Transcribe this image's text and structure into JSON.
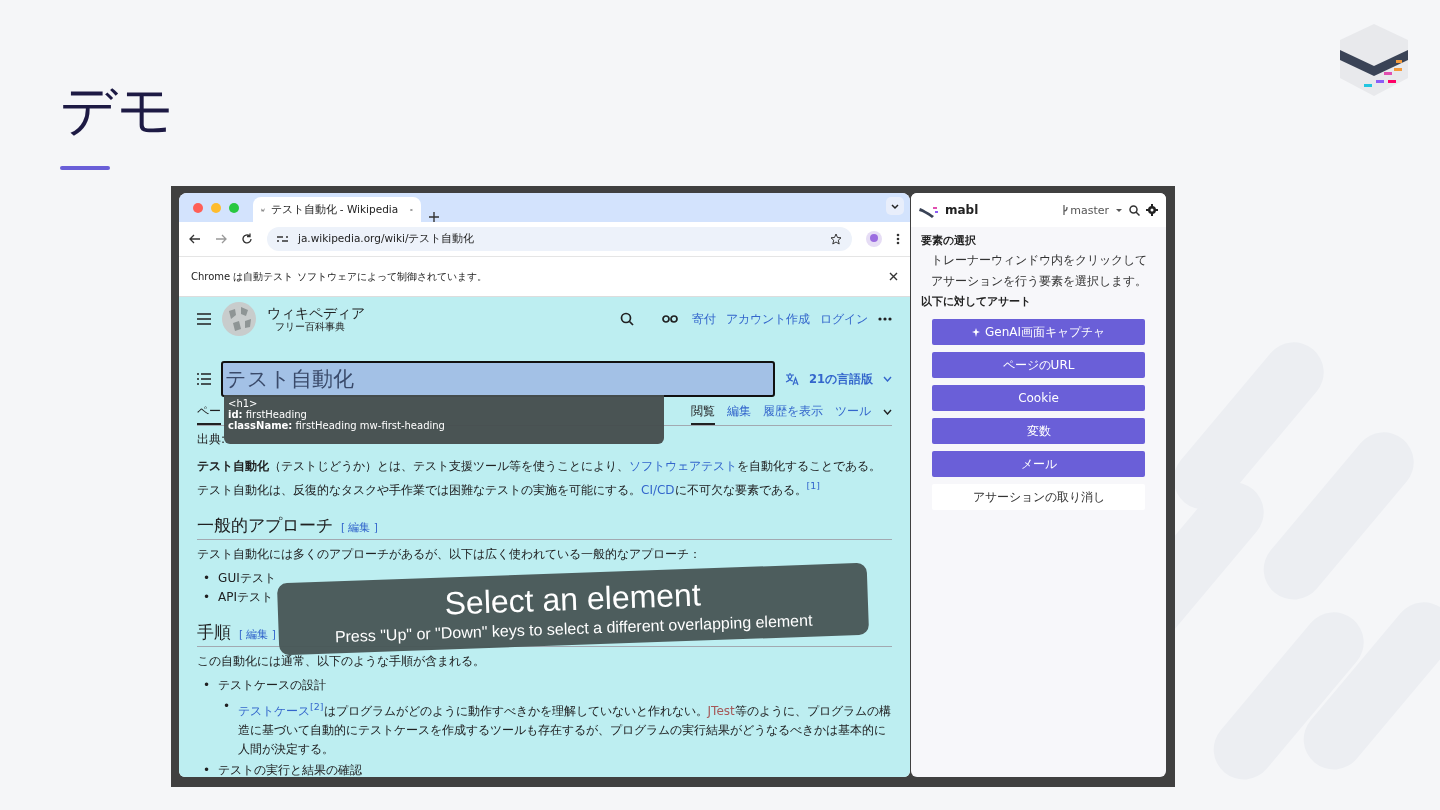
{
  "slide": {
    "title": "デモ"
  },
  "browser": {
    "tab_title": "テスト自動化 - Wikipedia",
    "url": "ja.wikipedia.org/wiki/テスト自動化",
    "infobar": "Chrome は自動テスト ソフトウェアによって制御されています。"
  },
  "wiki": {
    "site_name": "ウィキペディア",
    "tagline": "フリー百科事典",
    "header_links": [
      "寄付",
      "アカウント作成",
      "ログイン"
    ],
    "heading": "テスト自動化",
    "languages": "21の言語版",
    "left_tabs": [
      {
        "label": "ペー",
        "selected": true
      }
    ],
    "right_tabs": [
      {
        "label": "閲覧",
        "selected": true
      },
      {
        "label": "編集",
        "selected": false
      },
      {
        "label": "履歴を表示",
        "selected": false
      },
      {
        "label": "ツール",
        "selected": false
      }
    ],
    "source": "出典:",
    "blocks": [
      {
        "kind": "paragraph",
        "segments": [
          {
            "kind": "bold",
            "text": "テスト自動化"
          },
          {
            "kind": "plain",
            "text": "（テストじどうか）とは、テスト支援ツール等を使うことにより、"
          },
          {
            "kind": "link",
            "text": "ソフトウェアテスト"
          },
          {
            "kind": "plain",
            "text": "を自動化することである。テスト自動化は、反復的なタスクや手作業では困難なテストの実施を可能にする。"
          },
          {
            "kind": "link",
            "text": "CI/CD"
          },
          {
            "kind": "plain",
            "text": "に不可欠な要素である。"
          },
          {
            "kind": "ref",
            "text": "[1]"
          }
        ]
      },
      {
        "kind": "heading",
        "text": "一般的アプローチ",
        "edit": "[ 編集 ]"
      },
      {
        "kind": "paragraph",
        "segments": [
          {
            "kind": "plain",
            "text": "テスト自動化には多くのアプローチがあるが、以下は広く使われている一般的なアプローチ："
          }
        ]
      },
      {
        "kind": "list",
        "items": [
          {
            "marker": "•",
            "segments": [
              {
                "kind": "plain",
                "text": "GUIテスト"
              }
            ]
          },
          {
            "marker": "•",
            "segments": [
              {
                "kind": "plain",
                "text": "APIテスト"
              }
            ]
          }
        ]
      },
      {
        "kind": "heading",
        "text": "手順",
        "edit": "[ 編集 ]"
      },
      {
        "kind": "paragraph",
        "segments": [
          {
            "kind": "plain",
            "text": "この自動化には通常、以下のような手順が含まれる。"
          }
        ]
      },
      {
        "kind": "list",
        "items": [
          {
            "marker": "•",
            "segments": [
              {
                "kind": "plain",
                "text": "テストケースの設計"
              }
            ],
            "children": [
              {
                "marker": "•",
                "segments": [
                  {
                    "kind": "link",
                    "text": "テストケース"
                  },
                  {
                    "kind": "ref",
                    "text": "[2]"
                  },
                  {
                    "kind": "plain",
                    "text": "はプログラムがどのように動作すべきかを理解していないと作れない。"
                  },
                  {
                    "kind": "redlink",
                    "text": "JTest"
                  },
                  {
                    "kind": "plain",
                    "text": "等のように、プログラムの構造に基づいて自動的にテストケースを作成するツールも存在するが、プログラムの実行結果がどうなるべきかは基本的に人間が決定する。"
                  }
                ]
              }
            ]
          },
          {
            "marker": "•",
            "segments": [
              {
                "kind": "plain",
                "text": "テストの実行と結果の確認"
              }
            ]
          }
        ]
      }
    ]
  },
  "tooltip": {
    "tag": "<h1>",
    "lines": [
      {
        "key": "id:",
        "value": "firstHeading"
      },
      {
        "key": "className:",
        "value": "firstHeading mw-first-heading"
      }
    ]
  },
  "banner": {
    "title": "Select an element",
    "hint": "Press \"Up\" or \"Down\" keys to select a different overlapping element"
  },
  "mabl": {
    "name": "mabl",
    "branch": "master",
    "select_title": "要素の選択",
    "select_lines": [
      "トレーナーウィンドウ内をクリックして",
      "アサーションを行う要素を選択します。"
    ],
    "assert_title": "以下に対してアサート",
    "buttons": [
      {
        "label": "GenAI画面キャプチャ",
        "kind": "ai"
      },
      {
        "label": "ページのURL",
        "kind": "primary"
      },
      {
        "label": "Cookie",
        "kind": "primary"
      },
      {
        "label": "変数",
        "kind": "primary"
      },
      {
        "label": "メール",
        "kind": "primary"
      },
      {
        "label": "アサーションの取り消し",
        "kind": "secondary"
      }
    ]
  }
}
